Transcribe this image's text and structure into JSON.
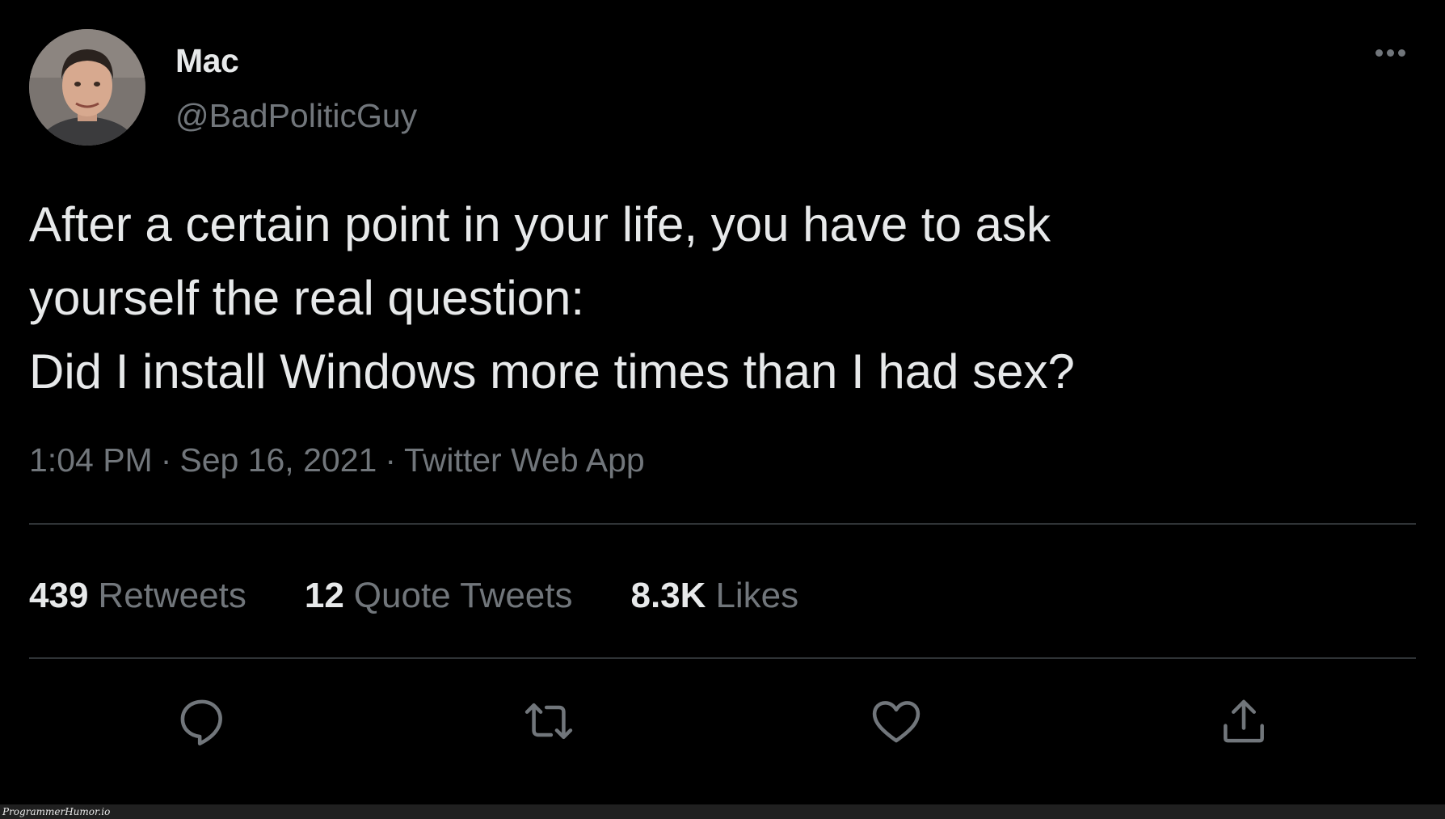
{
  "tweet": {
    "display_name": "Mac",
    "handle": "@BadPoliticGuy",
    "text_lines": [
      "After a certain point in your life, you have to ask",
      "yourself the real question:",
      "Did I install Windows more times than I had sex?"
    ],
    "time": "1:04 PM",
    "date": "Sep 16, 2021",
    "source": "Twitter Web App",
    "separator": "·",
    "stats": {
      "retweets": {
        "count": "439",
        "label": "Retweets"
      },
      "quotes": {
        "count": "12",
        "label": "Quote Tweets"
      },
      "likes": {
        "count": "8.3K",
        "label": "Likes"
      }
    },
    "actions": [
      "reply-icon",
      "retweet-icon",
      "like-icon",
      "share-icon"
    ]
  },
  "watermark": "ProgrammerHumor.io",
  "colors": {
    "background": "#000000",
    "primary_text": "#e7e9ea",
    "secondary_text": "#71767b",
    "divider": "#2f3336"
  }
}
